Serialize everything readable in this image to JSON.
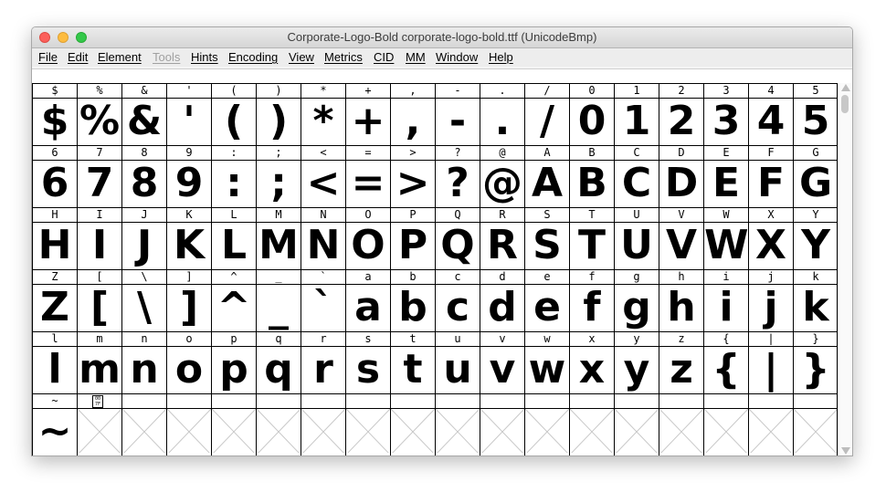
{
  "window": {
    "title": "Corporate-Logo-Bold  corporate-logo-bold.ttf (UnicodeBmp)"
  },
  "menu": [
    {
      "label": "File",
      "enabled": true
    },
    {
      "label": "Edit",
      "enabled": true
    },
    {
      "label": "Element",
      "enabled": true
    },
    {
      "label": "Tools",
      "enabled": false
    },
    {
      "label": "Hints",
      "enabled": true
    },
    {
      "label": "Encoding",
      "enabled": true
    },
    {
      "label": "View",
      "enabled": true
    },
    {
      "label": "Metrics",
      "enabled": true
    },
    {
      "label": "CID",
      "enabled": true
    },
    {
      "label": "MM",
      "enabled": true
    },
    {
      "label": "Window",
      "enabled": true
    },
    {
      "label": "Help",
      "enabled": true
    }
  ],
  "font_view": {
    "rows": [
      {
        "cells": [
          {
            "label": "$",
            "glyph": "$"
          },
          {
            "label": "%",
            "glyph": "%"
          },
          {
            "label": "&",
            "glyph": "&"
          },
          {
            "label": "'",
            "glyph": "'"
          },
          {
            "label": "(",
            "glyph": "("
          },
          {
            "label": ")",
            "glyph": ")"
          },
          {
            "label": "*",
            "glyph": "*"
          },
          {
            "label": "+",
            "glyph": "+"
          },
          {
            "label": ",",
            "glyph": ","
          },
          {
            "label": "-",
            "glyph": "-"
          },
          {
            "label": ".",
            "glyph": "."
          },
          {
            "label": "/",
            "glyph": "/"
          },
          {
            "label": "0",
            "glyph": "0"
          },
          {
            "label": "1",
            "glyph": "1"
          },
          {
            "label": "2",
            "glyph": "2"
          },
          {
            "label": "3",
            "glyph": "3"
          },
          {
            "label": "4",
            "glyph": "4"
          },
          {
            "label": "5",
            "glyph": "5"
          }
        ]
      },
      {
        "cells": [
          {
            "label": "6",
            "glyph": "6"
          },
          {
            "label": "7",
            "glyph": "7"
          },
          {
            "label": "8",
            "glyph": "8"
          },
          {
            "label": "9",
            "glyph": "9"
          },
          {
            "label": ":",
            "glyph": ":"
          },
          {
            "label": ";",
            "glyph": ";"
          },
          {
            "label": "<",
            "glyph": "<"
          },
          {
            "label": "=",
            "glyph": "="
          },
          {
            "label": ">",
            "glyph": ">"
          },
          {
            "label": "?",
            "glyph": "?"
          },
          {
            "label": "@",
            "glyph": "@"
          },
          {
            "label": "A",
            "glyph": "A"
          },
          {
            "label": "B",
            "glyph": "B"
          },
          {
            "label": "C",
            "glyph": "C"
          },
          {
            "label": "D",
            "glyph": "D"
          },
          {
            "label": "E",
            "glyph": "E"
          },
          {
            "label": "F",
            "glyph": "F"
          },
          {
            "label": "G",
            "glyph": "G"
          }
        ]
      },
      {
        "cells": [
          {
            "label": "H",
            "glyph": "H"
          },
          {
            "label": "I",
            "glyph": "I"
          },
          {
            "label": "J",
            "glyph": "J"
          },
          {
            "label": "K",
            "glyph": "K"
          },
          {
            "label": "L",
            "glyph": "L"
          },
          {
            "label": "M",
            "glyph": "M"
          },
          {
            "label": "N",
            "glyph": "N"
          },
          {
            "label": "O",
            "glyph": "O"
          },
          {
            "label": "P",
            "glyph": "P"
          },
          {
            "label": "Q",
            "glyph": "Q"
          },
          {
            "label": "R",
            "glyph": "R"
          },
          {
            "label": "S",
            "glyph": "S"
          },
          {
            "label": "T",
            "glyph": "T"
          },
          {
            "label": "U",
            "glyph": "U"
          },
          {
            "label": "V",
            "glyph": "V"
          },
          {
            "label": "W",
            "glyph": "W"
          },
          {
            "label": "X",
            "glyph": "X"
          },
          {
            "label": "Y",
            "glyph": "Y"
          }
        ]
      },
      {
        "cells": [
          {
            "label": "Z",
            "glyph": "Z"
          },
          {
            "label": "[",
            "glyph": "["
          },
          {
            "label": "\\",
            "glyph": "\\"
          },
          {
            "label": "]",
            "glyph": "]"
          },
          {
            "label": "^",
            "glyph": "^"
          },
          {
            "label": "_",
            "glyph": "_"
          },
          {
            "label": "`",
            "glyph": "`"
          },
          {
            "label": "a",
            "glyph": "a"
          },
          {
            "label": "b",
            "glyph": "b"
          },
          {
            "label": "c",
            "glyph": "c"
          },
          {
            "label": "d",
            "glyph": "d"
          },
          {
            "label": "e",
            "glyph": "e"
          },
          {
            "label": "f",
            "glyph": "f"
          },
          {
            "label": "g",
            "glyph": "g"
          },
          {
            "label": "h",
            "glyph": "h"
          },
          {
            "label": "i",
            "glyph": "i"
          },
          {
            "label": "j",
            "glyph": "j"
          },
          {
            "label": "k",
            "glyph": "k"
          }
        ]
      },
      {
        "cells": [
          {
            "label": "l",
            "glyph": "l"
          },
          {
            "label": "m",
            "glyph": "m"
          },
          {
            "label": "n",
            "glyph": "n"
          },
          {
            "label": "o",
            "glyph": "o"
          },
          {
            "label": "p",
            "glyph": "p"
          },
          {
            "label": "q",
            "glyph": "q"
          },
          {
            "label": "r",
            "glyph": "r"
          },
          {
            "label": "s",
            "glyph": "s"
          },
          {
            "label": "t",
            "glyph": "t"
          },
          {
            "label": "u",
            "glyph": "u"
          },
          {
            "label": "v",
            "glyph": "v"
          },
          {
            "label": "w",
            "glyph": "w"
          },
          {
            "label": "x",
            "glyph": "x"
          },
          {
            "label": "y",
            "glyph": "y"
          },
          {
            "label": "z",
            "glyph": "z"
          },
          {
            "label": "{",
            "glyph": "{"
          },
          {
            "label": "|",
            "glyph": "|"
          },
          {
            "label": "}",
            "glyph": "}"
          }
        ]
      },
      {
        "cells": [
          {
            "label": "~",
            "glyph": "~"
          },
          {
            "label": "",
            "hex": [
              "00",
              "7F"
            ],
            "glyph": ""
          },
          {
            "label": "",
            "glyph": ""
          },
          {
            "label": "",
            "glyph": ""
          },
          {
            "label": "",
            "glyph": ""
          },
          {
            "label": "",
            "glyph": ""
          },
          {
            "label": "",
            "glyph": ""
          },
          {
            "label": "",
            "glyph": ""
          },
          {
            "label": "",
            "glyph": ""
          },
          {
            "label": "",
            "glyph": ""
          },
          {
            "label": "",
            "glyph": ""
          },
          {
            "label": "",
            "glyph": ""
          },
          {
            "label": "",
            "glyph": ""
          },
          {
            "label": "",
            "glyph": ""
          },
          {
            "label": "",
            "glyph": ""
          },
          {
            "label": "",
            "glyph": ""
          },
          {
            "label": "",
            "glyph": ""
          },
          {
            "label": "",
            "glyph": ""
          }
        ]
      }
    ]
  }
}
